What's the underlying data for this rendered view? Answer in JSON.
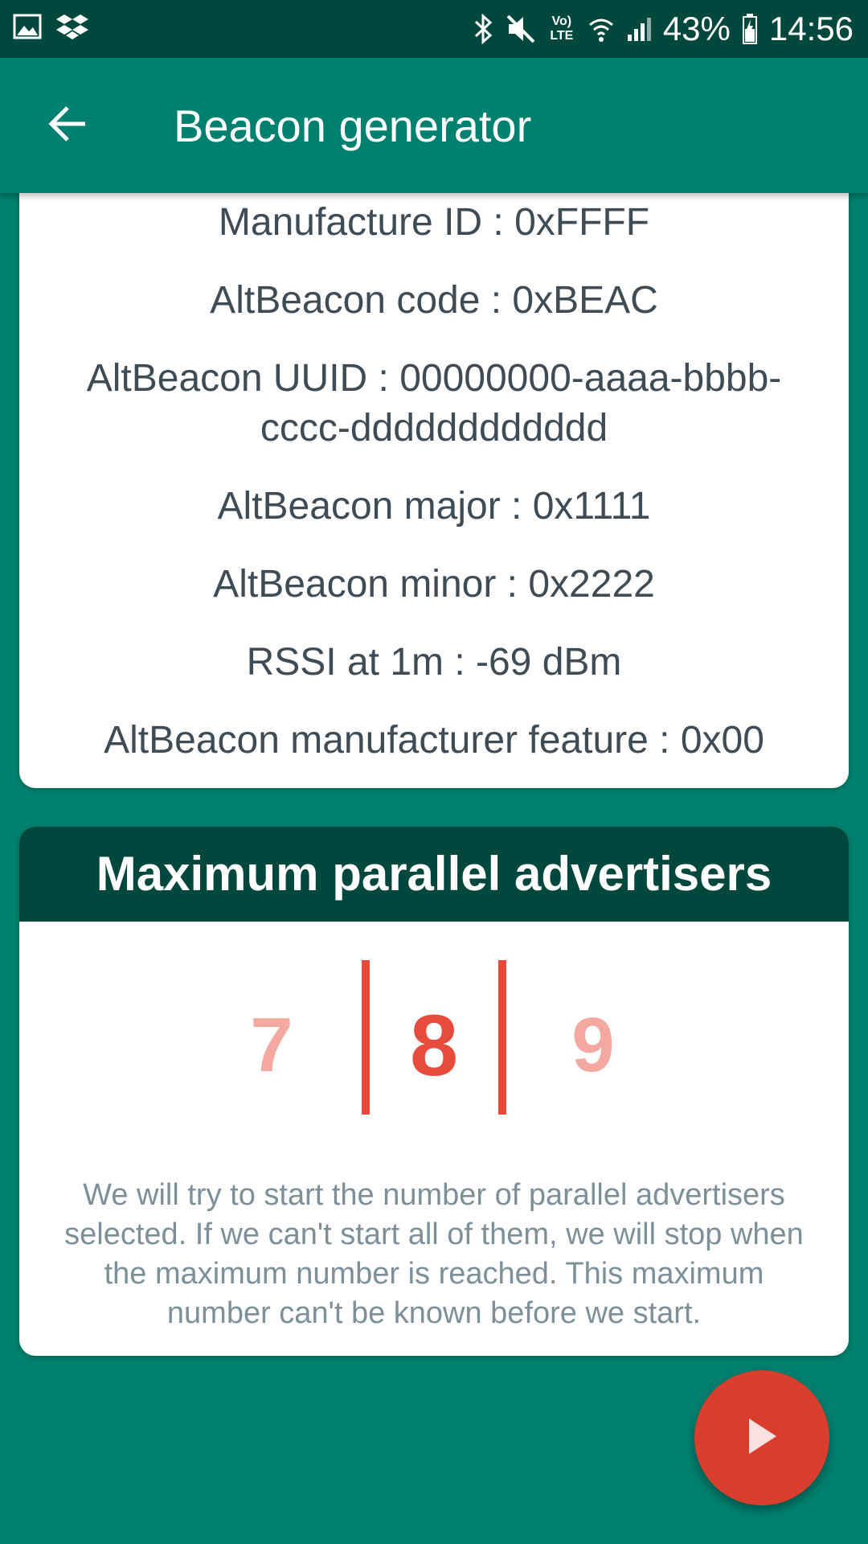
{
  "status_bar": {
    "battery_percent": "43%",
    "time": "14:56",
    "network_label": "Vo) LTE",
    "icons": [
      "image-icon",
      "dropbox-icon",
      "bluetooth-icon",
      "mute-icon",
      "volte-icon",
      "wifi-icon",
      "signal-icon",
      "battery-icon"
    ]
  },
  "app_bar": {
    "title": "Beacon generator",
    "back_icon": "arrow-back-icon"
  },
  "beacon_info": {
    "manufacture_id": "Manufacture ID : 0xFFFF",
    "code": "AltBeacon code : 0xBEAC",
    "uuid_line1": "AltBeacon UUID : 00000000-aaaa-bbbb-",
    "uuid_line2": "cccc-dddddddddddd",
    "major": "AltBeacon major : 0x1111",
    "minor": "AltBeacon minor : 0x2222",
    "rssi": "RSSI at 1m : -69 dBm",
    "feature": "AltBeacon manufacturer feature : 0x00"
  },
  "advertisers": {
    "title": "Maximum parallel advertisers",
    "picker": {
      "previous": "7",
      "selected": "8",
      "next": "9"
    },
    "description_lines": [
      "We will try to start the number of parallel advertisers",
      "selected. If we can't start all of them, we will stop when",
      "the maximum number is reached. This maximum",
      "number can't be known before we start."
    ]
  },
  "fab": {
    "icon": "play-icon"
  },
  "colors": {
    "primary": "#00806e",
    "primary_dark": "#00473d",
    "accent": "#d93d2e",
    "picker_selected": "#e84a3c",
    "picker_faded": "#f5a8a0",
    "text_dark": "#3f4b55",
    "text_muted": "#7d8f98"
  }
}
